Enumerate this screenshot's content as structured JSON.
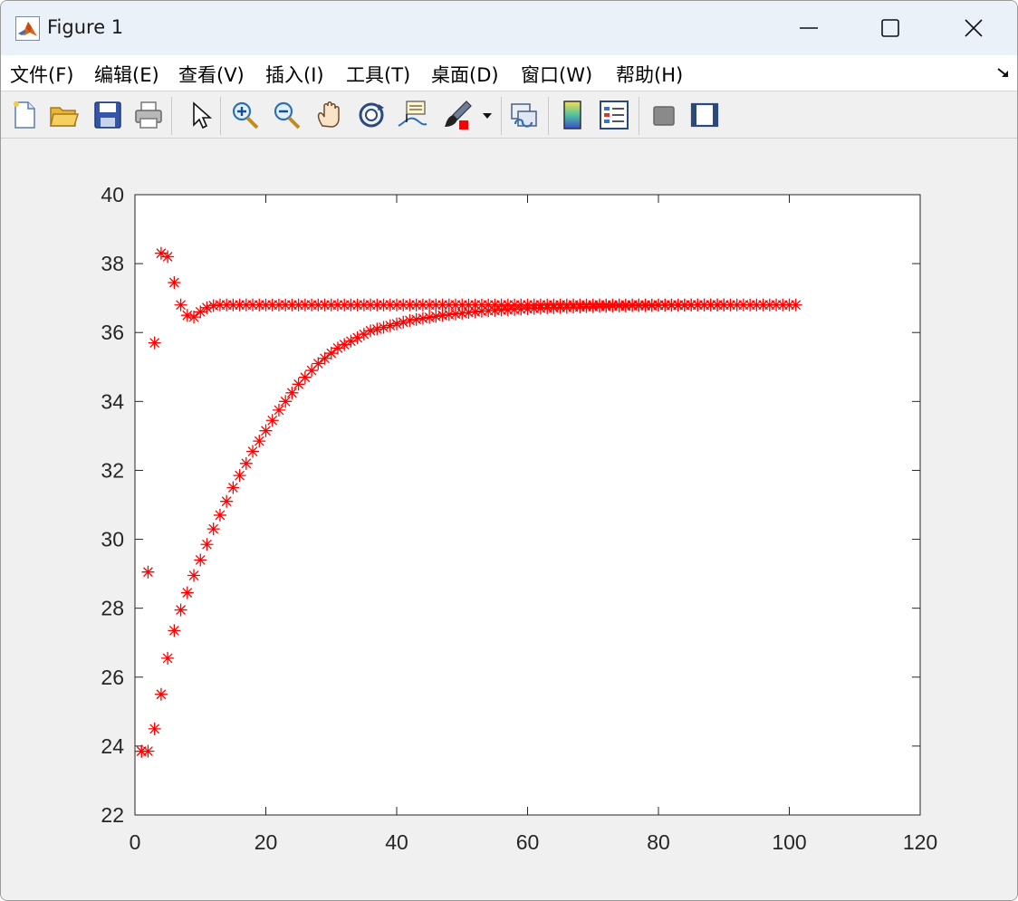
{
  "window": {
    "title": "Figure 1",
    "icon": "matlab-logo-icon"
  },
  "menu": {
    "items": [
      {
        "label": "文件(F)",
        "key": "F"
      },
      {
        "label": "编辑(E)",
        "key": "E"
      },
      {
        "label": "查看(V)",
        "key": "V"
      },
      {
        "label": "插入(I)",
        "key": "I"
      },
      {
        "label": "工具(T)",
        "key": "T"
      },
      {
        "label": "桌面(D)",
        "key": "D"
      },
      {
        "label": "窗口(W)",
        "key": "W"
      },
      {
        "label": "帮助(H)",
        "key": "H"
      }
    ]
  },
  "toolbar": {
    "tools": [
      "new-figure-icon",
      "open-file-icon",
      "save-icon",
      "print-icon",
      "edit-plot-arrow-icon",
      "zoom-in-icon",
      "zoom-out-icon",
      "pan-hand-icon",
      "rotate-3d-icon",
      "data-cursor-icon",
      "brush-icon",
      "brush-dropdown-icon",
      "link-plot-icon",
      "colorbar-icon",
      "legend-icon",
      "hide-plot-tools-icon",
      "show-plot-tools-icon"
    ]
  },
  "chart_data": {
    "type": "scatter",
    "title": "",
    "xlabel": "",
    "ylabel": "",
    "xlim": [
      0,
      120
    ],
    "ylim": [
      22,
      40
    ],
    "xticks": [
      0,
      20,
      40,
      60,
      80,
      100,
      120
    ],
    "yticks": [
      22,
      24,
      26,
      28,
      30,
      32,
      34,
      36,
      38,
      40
    ],
    "marker": "*",
    "marker_color": "#ff0000",
    "grid": false,
    "legend": "none",
    "series": [
      {
        "x": [
          1,
          2,
          3,
          4,
          5,
          6,
          7,
          8,
          9,
          10,
          11,
          12,
          13,
          14,
          15,
          16,
          17,
          18,
          19,
          20,
          21,
          22,
          23,
          24,
          25,
          26,
          27,
          28,
          29,
          30,
          31,
          32,
          33,
          34,
          35,
          36,
          37,
          38,
          39,
          40,
          41,
          42,
          43,
          44,
          45,
          46,
          47,
          48,
          49,
          50,
          51,
          52,
          53,
          54,
          55,
          56,
          57,
          58,
          59,
          60,
          61,
          62,
          63,
          64,
          65,
          66,
          67,
          68,
          69,
          70,
          71,
          72,
          73,
          74,
          75,
          76,
          77,
          78,
          79,
          80,
          81,
          82,
          83,
          84,
          85,
          86,
          87,
          88,
          89,
          90,
          91,
          92,
          93,
          94,
          95,
          96,
          97,
          98,
          99,
          100,
          101
        ],
        "y": [
          23.85,
          29.05,
          35.7,
          38.3,
          38.2,
          37.45,
          36.8,
          36.5,
          36.45,
          36.6,
          36.72,
          36.78,
          36.8,
          36.8,
          36.8,
          36.8,
          36.8,
          36.8,
          36.8,
          36.8,
          36.8,
          36.8,
          36.8,
          36.8,
          36.8,
          36.8,
          36.8,
          36.8,
          36.8,
          36.8,
          36.8,
          36.8,
          36.8,
          36.8,
          36.8,
          36.8,
          36.8,
          36.8,
          36.8,
          36.8,
          36.8,
          36.8,
          36.8,
          36.8,
          36.8,
          36.8,
          36.8,
          36.8,
          36.8,
          36.8,
          36.8,
          36.8,
          36.8,
          36.8,
          36.8,
          36.8,
          36.8,
          36.8,
          36.8,
          36.8,
          36.8,
          36.8,
          36.8,
          36.8,
          36.8,
          36.8,
          36.8,
          36.8,
          36.8,
          36.8,
          36.8,
          36.8,
          36.8,
          36.8,
          36.8,
          36.8,
          36.8,
          36.8,
          36.8,
          36.8,
          36.8,
          36.8,
          36.8,
          36.8,
          36.8,
          36.8,
          36.8,
          36.8,
          36.8,
          36.8,
          36.8,
          36.8,
          36.8,
          36.8,
          36.8,
          36.8,
          36.8,
          36.8,
          36.8,
          36.8,
          36.8
        ]
      },
      {
        "x": [
          1,
          2,
          3,
          4,
          5,
          6,
          7,
          8,
          9,
          10,
          11,
          12,
          13,
          14,
          15,
          16,
          17,
          18,
          19,
          20,
          21,
          22,
          23,
          24,
          25,
          26,
          27,
          28,
          29,
          30,
          31,
          32,
          33,
          34,
          35,
          36,
          37,
          38,
          39,
          40,
          41,
          42,
          43,
          44,
          45,
          46,
          47,
          48,
          49,
          50,
          51,
          52,
          53,
          54,
          55,
          56,
          57,
          58,
          59,
          60,
          61,
          62,
          63,
          64,
          65,
          66,
          67,
          68,
          69,
          70,
          71,
          72,
          73,
          74,
          75,
          76,
          77,
          78,
          79,
          80,
          81,
          82,
          83,
          84,
          85,
          86,
          87,
          88,
          89,
          90
        ],
        "y": [
          23.85,
          23.85,
          24.5,
          25.5,
          26.55,
          27.35,
          27.95,
          28.45,
          28.95,
          29.4,
          29.85,
          30.3,
          30.7,
          31.1,
          31.5,
          31.85,
          32.2,
          32.55,
          32.85,
          33.15,
          33.45,
          33.75,
          34.0,
          34.25,
          34.5,
          34.7,
          34.9,
          35.1,
          35.25,
          35.4,
          35.55,
          35.65,
          35.75,
          35.85,
          35.95,
          36.05,
          36.1,
          36.15,
          36.2,
          36.25,
          36.3,
          36.35,
          36.38,
          36.41,
          36.44,
          36.47,
          36.5,
          36.52,
          36.54,
          36.56,
          36.58,
          36.6,
          36.62,
          36.63,
          36.64,
          36.65,
          36.66,
          36.67,
          36.68,
          36.69,
          36.7,
          36.71,
          36.72,
          36.72,
          36.73,
          36.73,
          36.74,
          36.74,
          36.75,
          36.75,
          36.76,
          36.76,
          36.77,
          36.77,
          36.77,
          36.78,
          36.78,
          36.78,
          36.78,
          36.79,
          36.79,
          36.79,
          36.79,
          36.79,
          36.8,
          36.8,
          36.8,
          36.8,
          36.8,
          36.8
        ]
      }
    ]
  }
}
